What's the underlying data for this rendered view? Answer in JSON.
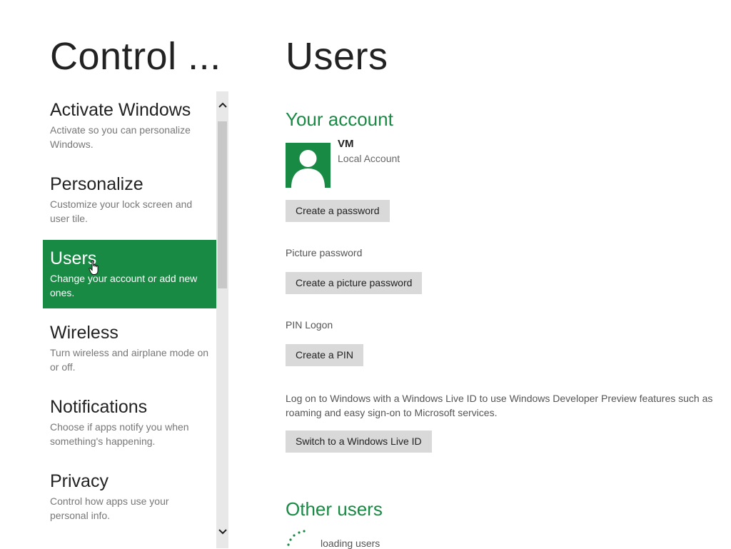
{
  "app": {
    "title": "Control ..."
  },
  "page": {
    "title": "Users"
  },
  "sidebar": {
    "items": [
      {
        "label": "Activate Windows",
        "description": "Activate so you can personalize Windows.",
        "selected": false
      },
      {
        "label": "Personalize",
        "description": "Customize your lock screen and user tile.",
        "selected": false
      },
      {
        "label": "Users",
        "description": "Change your account or add new ones.",
        "selected": true
      },
      {
        "label": "Wireless",
        "description": "Turn wireless and airplane mode on or off.",
        "selected": false
      },
      {
        "label": "Notifications",
        "description": "Choose if apps notify you when something's happening.",
        "selected": false
      },
      {
        "label": "Privacy",
        "description": "Control how apps use your personal info.",
        "selected": false
      }
    ]
  },
  "account": {
    "heading": "Your account",
    "name": "VM",
    "type": "Local Account",
    "avatar_icon": "user-silhouette-icon",
    "create_password_label": "Create a password",
    "picture_password_label": "Picture password",
    "create_picture_password_label": "Create a picture password",
    "pin_logon_label": "PIN Logon",
    "create_pin_label": "Create a PIN",
    "live_id_info": "Log on to Windows with a Windows Live ID to use Windows Developer Preview features such as roaming and easy sign-on to Microsoft services.",
    "switch_live_id_label": "Switch to a Windows Live ID"
  },
  "other_users": {
    "heading": "Other users",
    "loading_text": "loading users"
  },
  "colors": {
    "accent": "#188a44",
    "button_bg": "#d9d9d9",
    "scrollbar_track": "#e8e8e8",
    "scrollbar_thumb": "#c8c8c8"
  }
}
